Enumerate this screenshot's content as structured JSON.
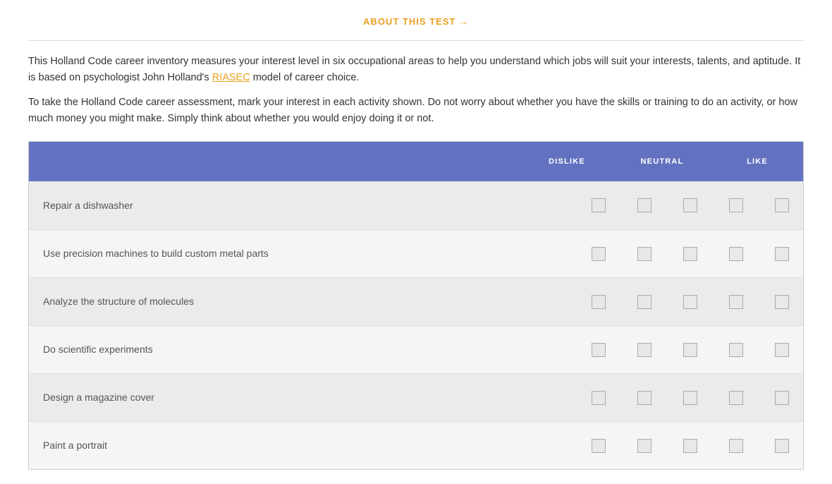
{
  "header": {
    "about_link": "ABOUT THIS TEST"
  },
  "intro": {
    "paragraph1": "This Holland Code career inventory measures your interest level in six occupational areas to help you understand which jobs will suit your interests, talents, and aptitude. It is based on psychologist John Holland's ",
    "riasec": "RIASEC",
    "paragraph1_end": " model of career choice.",
    "paragraph2": "To take the Holland Code career assessment, mark your interest in each activity shown. Do not worry about whether you have the skills or training to do an activity, or how much money you might make. Simply think about whether you would enjoy doing it or not."
  },
  "table": {
    "col_dislike": "DISLIKE",
    "col_neutral": "NEUTRAL",
    "col_like": "LIKE",
    "rows": [
      {
        "activity": "Repair a dishwasher"
      },
      {
        "activity": "Use precision machines to build custom metal parts"
      },
      {
        "activity": "Analyze the structure of molecules"
      },
      {
        "activity": "Do scientific experiments"
      },
      {
        "activity": "Design a magazine cover"
      },
      {
        "activity": "Paint a portrait"
      }
    ]
  }
}
